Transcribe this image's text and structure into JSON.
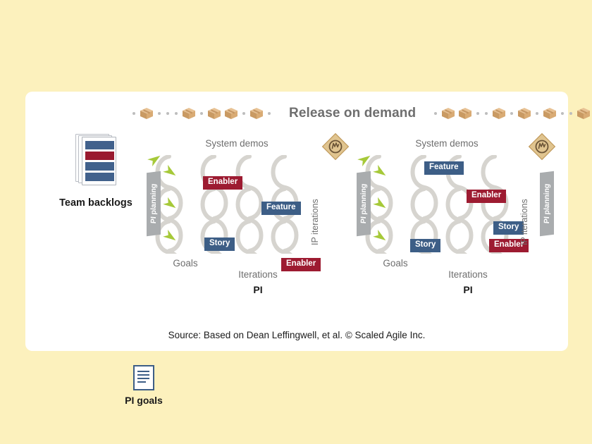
{
  "colors": {
    "page_background": "#fcf1bd",
    "card_background": "#ffffff",
    "feature_badge": "#3d5e86",
    "story_badge": "#3d5e86",
    "enabler_badge": "#9d1b31",
    "chain_gray": "#d6d4cf",
    "arrow_green": "#a6c939",
    "pi_planning_gray": "#a9acae",
    "label_gray": "#6e6e6e",
    "diamond_tan": "#e0c48f",
    "package_tan": "#d9a968"
  },
  "header": {
    "title": "Release on demand",
    "left_train": [
      "dot",
      "package",
      "dot",
      "dot",
      "dot",
      "package",
      "dot",
      "package",
      "package",
      "dot",
      "package",
      "dot"
    ],
    "right_train": [
      "dot",
      "package",
      "package",
      "dot",
      "dot",
      "package",
      "dot",
      "package",
      "dot",
      "package",
      "dot",
      "dot",
      "package"
    ],
    "package_icon": "package-box-icon",
    "dot_icon": "separator-dot-icon"
  },
  "team_backlogs": {
    "label": "Team backlogs",
    "icon": "stacked-backlog-icon",
    "bars": [
      "blue",
      "red",
      "blue",
      "blue"
    ]
  },
  "pi_goals": {
    "label": "PI goals",
    "icon": "document-lines-icon"
  },
  "program_increments": [
    {
      "id": "pi-1",
      "system_demos_label": "System demos",
      "pi_planning_label": "PI planning",
      "goals_label": "Goals",
      "iterations_label": "Iterations",
      "pi_label": "PI",
      "badges": [
        {
          "text": "Enabler",
          "type": "enabler"
        },
        {
          "text": "Feature",
          "type": "feature"
        },
        {
          "text": "Story",
          "type": "story"
        },
        {
          "text": "Enabler",
          "type": "enabler"
        }
      ]
    },
    {
      "id": "pi-2",
      "system_demos_label": "System demos",
      "pi_planning_label": "PI planning",
      "goals_label": "Goals",
      "iterations_label": "Iterations",
      "pi_label": "PI",
      "badges": [
        {
          "text": "Feature",
          "type": "feature"
        },
        {
          "text": "Enabler",
          "type": "enabler"
        },
        {
          "text": "Story",
          "type": "story"
        },
        {
          "text": "Enabler",
          "type": "enabler"
        },
        {
          "text": "Story",
          "type": "story"
        }
      ]
    }
  ],
  "ip_iterations": {
    "label_1": "IP iterations",
    "label_2": "IP iterations",
    "marker_icon": "ip-iteration-diamond-icon"
  },
  "trailing_pi_planning": {
    "label": "PI planning"
  },
  "source": {
    "text": "Source: Based on Dean Leffingwell, et al. © Scaled Agile Inc."
  }
}
